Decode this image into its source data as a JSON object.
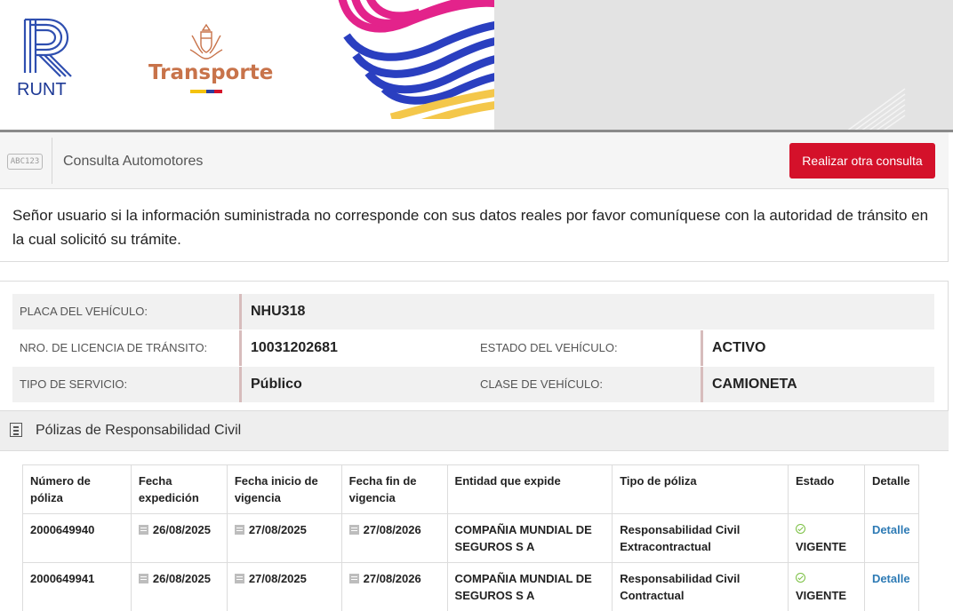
{
  "header": {
    "runt_text": "RUNT",
    "ministry_text": "Transporte",
    "colors": {
      "runt_blue": "#1e3a96",
      "transporte_orange": "#c8734a",
      "red_button": "#d4112a"
    }
  },
  "query_bar": {
    "icon_text": "ABC123",
    "title": "Consulta Automotores",
    "button_label": "Realizar otra consulta"
  },
  "notice": {
    "text": "Señor usuario si la información suministrada no corresponde con sus datos reales por favor comuníquese con la autoridad de tránsito en la cual solicitó su trámite."
  },
  "vehicle": {
    "placa_label": "PLACA DEL VEHÍCULO:",
    "placa_value": "NHU318",
    "licencia_label": "NRO. DE LICENCIA DE TRÁNSITO:",
    "licencia_value": "10031202681",
    "estado_label": "ESTADO DEL VEHÍCULO:",
    "estado_value": "ACTIVO",
    "servicio_label": "TIPO DE SERVICIO:",
    "servicio_value": "Público",
    "clase_label": "CLASE DE VEHÍCULO:",
    "clase_value": "CAMIONETA"
  },
  "polizas": {
    "title": "Pólizas de Responsabilidad Civil",
    "headers": {
      "numero": "Número de póliza",
      "expedicion": "Fecha expedición",
      "inicio": "Fecha inicio de vigencia",
      "fin": "Fecha fin de vigencia",
      "entidad": "Entidad que expide",
      "tipo": "Tipo de póliza",
      "estado": "Estado",
      "detalle": "Detalle"
    },
    "rows": [
      {
        "numero": "2000649940",
        "expedicion": "26/08/2025",
        "inicio": "27/08/2025",
        "fin": "27/08/2026",
        "entidad": "COMPAÑIA MUNDIAL DE SEGUROS S A",
        "tipo": "Responsabilidad Civil Extracontractual",
        "estado": "VIGENTE",
        "detalle": "Detalle"
      },
      {
        "numero": "2000649941",
        "expedicion": "26/08/2025",
        "inicio": "27/08/2025",
        "fin": "27/08/2026",
        "entidad": "COMPAÑIA MUNDIAL DE SEGUROS S A",
        "tipo": "Responsabilidad Civil Contractual",
        "estado": "VIGENTE",
        "detalle": "Detalle"
      }
    ]
  }
}
